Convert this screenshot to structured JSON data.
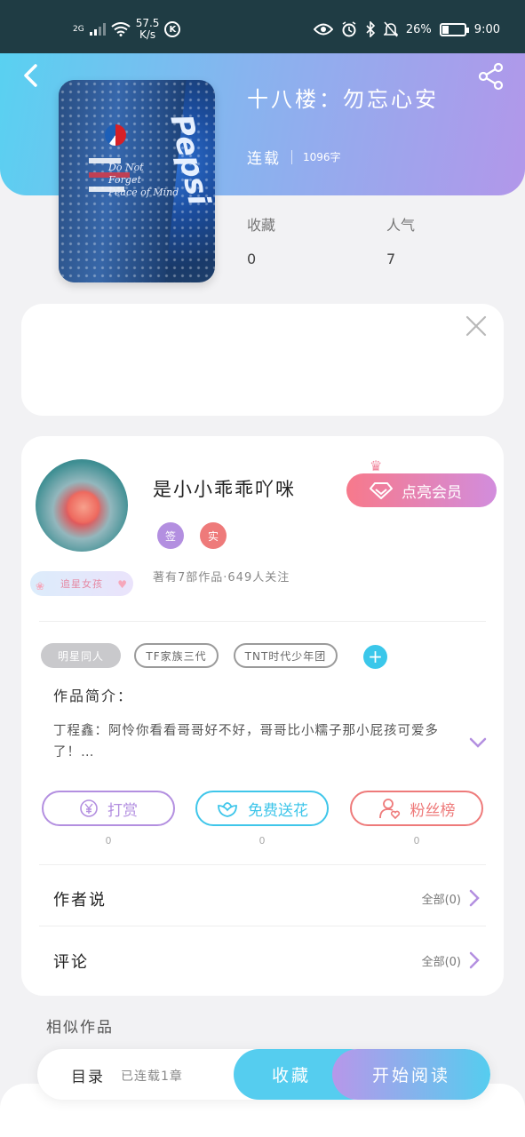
{
  "status_bar": {
    "network": "2G",
    "speed": "57.5",
    "speed_unit": "K/s",
    "k_badge": "K",
    "battery_text": "26%",
    "battery_level": 0.26,
    "time": "9:00"
  },
  "book": {
    "title": "十八楼：勿忘心安",
    "status": "连载",
    "word_count": "1096字",
    "cover_caption_1": "Do Not",
    "cover_caption_2": "Forget",
    "cover_caption_3": "Peace of Mind",
    "cover_brand": "Pepsi",
    "favorites_label": "收藏",
    "favorites_value": "0",
    "popularity_label": "人气",
    "popularity_value": "7"
  },
  "author": {
    "name": "是小小乖乖吖咪",
    "badge": "追星女孩",
    "tag_1": "签",
    "tag_2": "实",
    "description": "著有7部作品·649人关注",
    "vip_label": "点亮会员"
  },
  "tags": [
    "明星同人",
    "TF家族三代",
    "TNT时代少年团"
  ],
  "intro": {
    "heading": "作品简介：",
    "text": "丁程鑫：阿怜你看看哥哥好不好，哥哥比小糯子那小屁孩可爱多了！…"
  },
  "actions": [
    {
      "label": "打赏",
      "count": "0",
      "icon": "yen-coin-icon",
      "color": "#b38fe0"
    },
    {
      "label": "免费送花",
      "count": "0",
      "icon": "flower-icon",
      "color": "#3fc6ea"
    },
    {
      "label": "粉丝榜",
      "count": "0",
      "icon": "fan-user-icon",
      "color": "#ee7a7a"
    }
  ],
  "rows": [
    {
      "title": "作者说",
      "right": "全部(0)"
    },
    {
      "title": "评论",
      "right": "全部(0)"
    }
  ],
  "similar_heading": "相似作品",
  "bottom": {
    "catalog": "目录",
    "updated": "已连载1章",
    "favorite": "收藏",
    "read": "开始阅读"
  },
  "colors": {
    "header_start": "#59d1f1",
    "header_end": "#b297ea",
    "accent_blue": "#55cdef",
    "accent_purple": "#b797ea",
    "tag_purple": "#b38fe0",
    "tag_red": "#ee7a7a"
  }
}
